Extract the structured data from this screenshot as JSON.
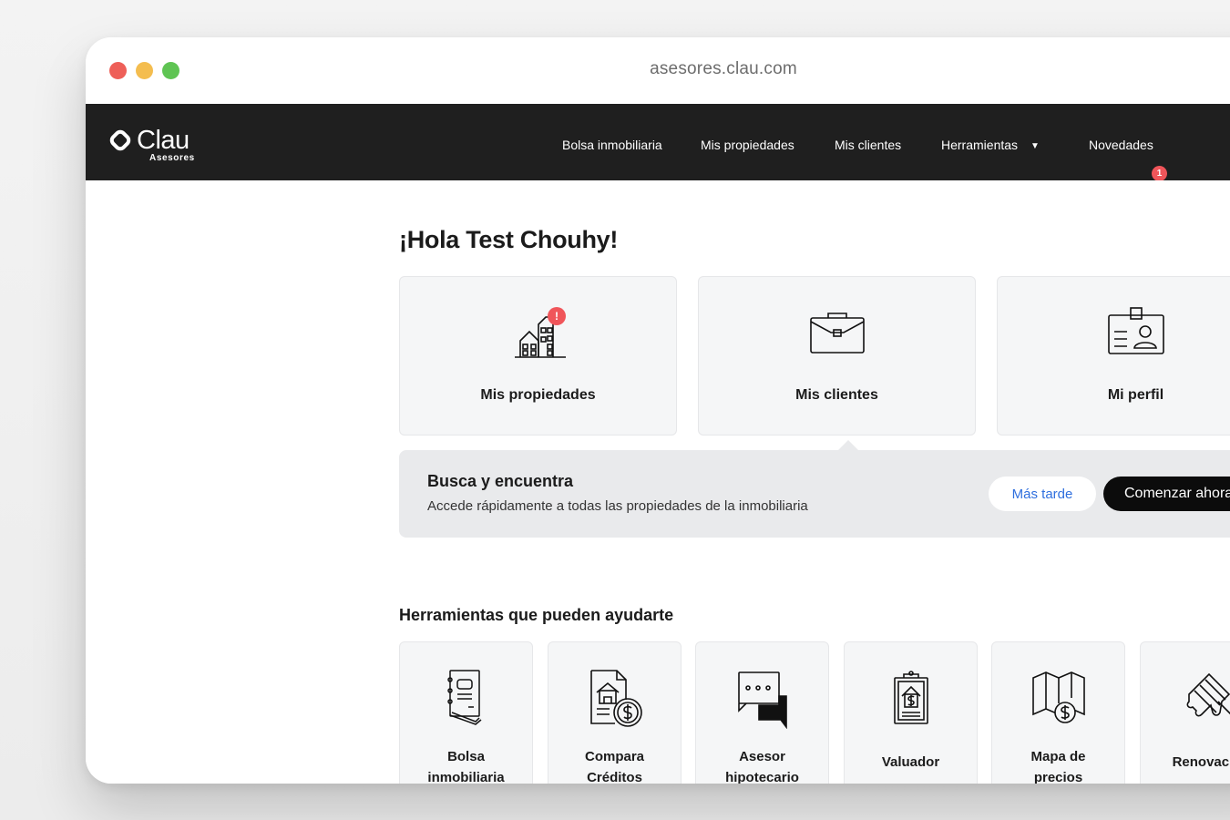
{
  "browser": {
    "url": "asesores.clau.com"
  },
  "brand": {
    "name": "Clau",
    "sub": "Asesores"
  },
  "nav": {
    "items": [
      "Bolsa inmobiliaria",
      "Mis propiedades",
      "Mis clientes",
      "Herramientas",
      "Novedades"
    ],
    "novedades_badge": "1"
  },
  "greeting": "¡Hola Test Chouhy!",
  "cards": [
    {
      "label": "Mis propiedades",
      "icon": "buildings-icon",
      "alert": "!"
    },
    {
      "label": "Mis clientes",
      "icon": "briefcase-icon"
    },
    {
      "label": "Mi perfil",
      "icon": "id-badge-icon"
    }
  ],
  "banner": {
    "title": "Busca y encuentra",
    "description": "Accede rápidamente a todas las propiedades de la inmobiliaria",
    "later_label": "Más tarde",
    "start_label": "Comenzar ahora"
  },
  "tools_title": "Herramientas que pueden ayudarte",
  "tools": [
    {
      "lines": [
        "Bolsa",
        "inmobiliaria"
      ],
      "icon": "notebook-icon"
    },
    {
      "lines": [
        "Compara",
        "Créditos"
      ],
      "icon": "credit-compare-icon"
    },
    {
      "lines": [
        "Asesor",
        "hipotecario"
      ],
      "icon": "chat-bubbles-icon"
    },
    {
      "lines": [
        "Valuador"
      ],
      "icon": "clipboard-dollar-icon"
    },
    {
      "lines": [
        "Mapa de",
        "precios"
      ],
      "icon": "price-map-icon"
    },
    {
      "lines": [
        "Renovacio"
      ],
      "icon": "paint-brush-icon"
    }
  ],
  "colors": {
    "nav_bg": "#1f1f1f",
    "accent_red": "#f0555a",
    "link_blue": "#2f6fde",
    "card_bg": "#f5f6f7"
  }
}
